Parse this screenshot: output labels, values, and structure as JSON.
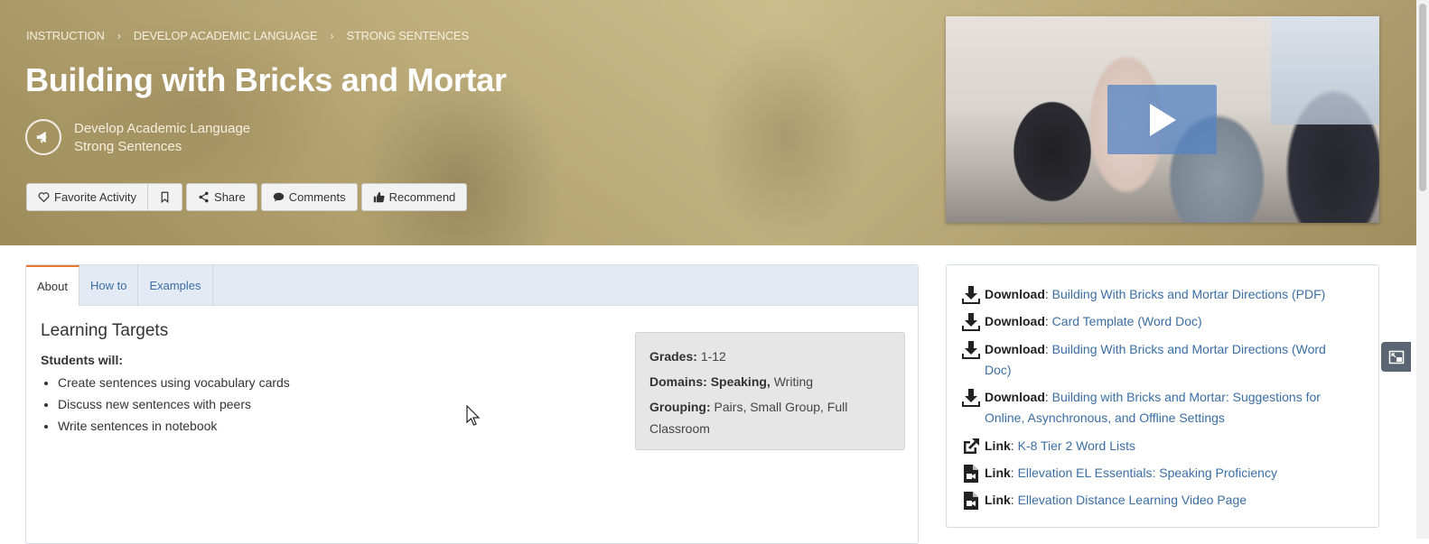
{
  "hero": {
    "breadcrumb": [
      "INSTRUCTION",
      "DEVELOP ACADEMIC LANGUAGE",
      "STRONG SENTENCES"
    ],
    "breadcrumb_separator": "›",
    "title": "Building with Bricks and Mortar",
    "badge_icon": "megaphone-icon",
    "subtitle_line1": "Develop Academic Language",
    "subtitle_line2": "Strong Sentences",
    "buttons": {
      "favorite": "Favorite Activity",
      "share": "Share",
      "comments": "Comments",
      "recommend": "Recommend"
    },
    "color": "#bcaa75"
  },
  "video": {
    "play_icon": "play-icon",
    "play_color": "#5484c4"
  },
  "tabs": [
    {
      "label": "About",
      "active": true
    },
    {
      "label": "How to",
      "active": false
    },
    {
      "label": "Examples",
      "active": false
    }
  ],
  "about": {
    "heading": "Learning Targets",
    "lead": "Students will:",
    "targets": [
      "Create sentences using vocabulary cards",
      "Discuss new sentences with peers",
      "Write sentences in notebook"
    ],
    "info": {
      "grades_label": "Grades:",
      "grades_value": "1-12",
      "domains_label": "Domains:",
      "domains_bold": "Speaking,",
      "domains_value": "Writing",
      "grouping_label": "Grouping:",
      "grouping_value": "Pairs, Small Group, Full Classroom"
    }
  },
  "resources": [
    {
      "icon": "download-icon",
      "kind": "Download",
      "sep": ":",
      "title": "Building With Bricks and Mortar Directions (PDF)"
    },
    {
      "icon": "download-icon",
      "kind": "Download",
      "sep": ":",
      "title": "Card Template (Word Doc)"
    },
    {
      "icon": "download-icon",
      "kind": "Download",
      "sep": ":",
      "title": "Building With Bricks and Mortar Directions (Word Doc)"
    },
    {
      "icon": "download-icon",
      "kind": "Download",
      "sep": ":",
      "title": "Building with Bricks and Mortar: Suggestions for Online, Asynchronous, and Offline Settings"
    },
    {
      "icon": "external-link-icon",
      "kind": "Link",
      "sep": ":",
      "title": "K-8 Tier 2 Word Lists"
    },
    {
      "icon": "video-file-icon",
      "kind": "Link",
      "sep": ":",
      "title": "Ellevation EL Essentials: Speaking Proficiency"
    },
    {
      "icon": "video-file-icon",
      "kind": "Link",
      "sep": ":",
      "title": "Ellevation Distance Learning Video Page"
    }
  ],
  "colors": {
    "link": "#3a6ea5",
    "tab_accent": "#e8772e",
    "tab_bar": "#e4eaf4",
    "info_box": "#e6e6e6"
  }
}
